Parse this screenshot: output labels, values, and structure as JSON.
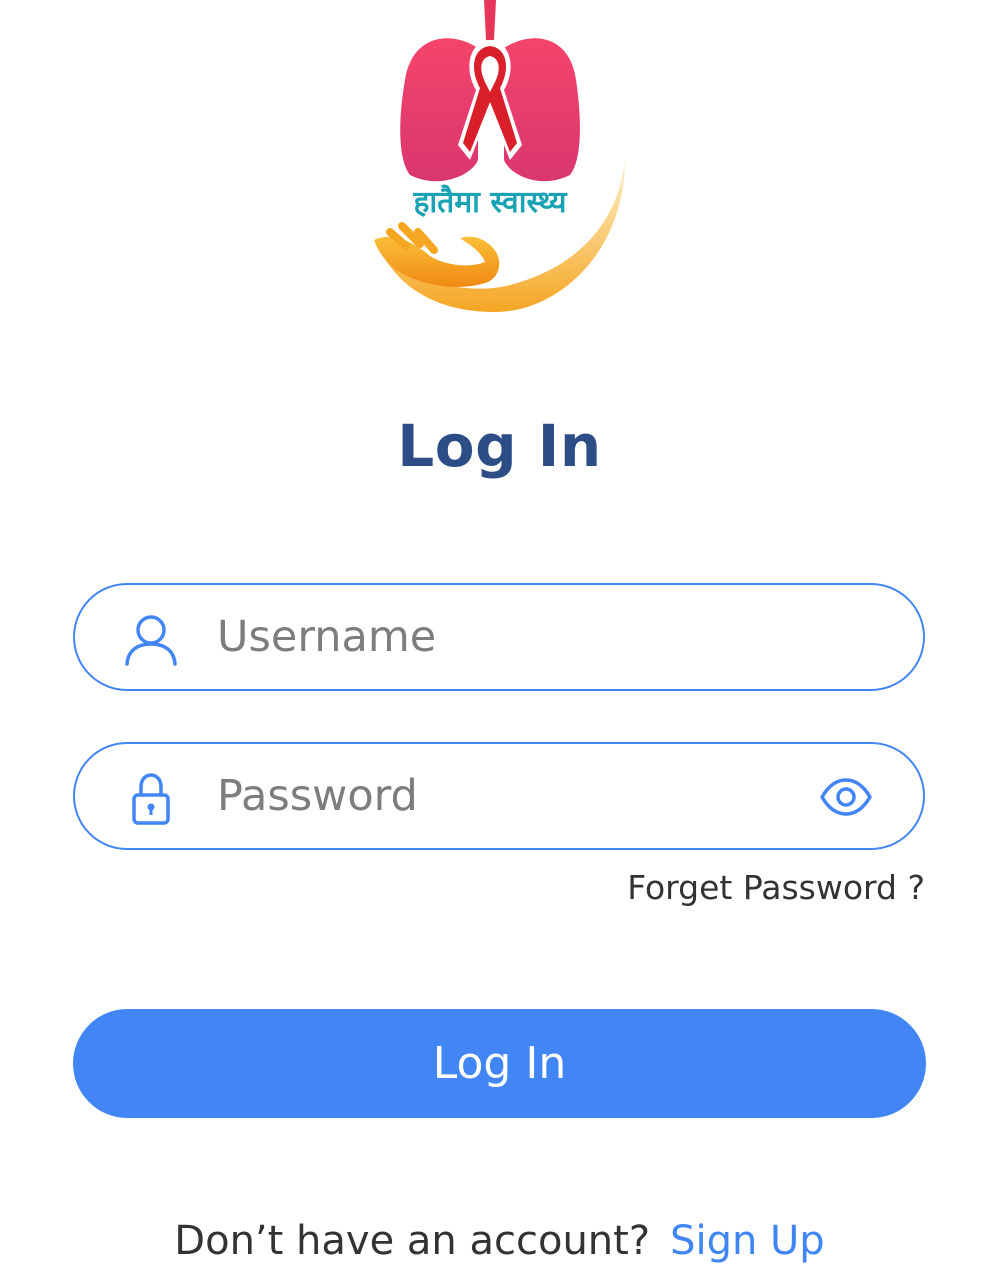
{
  "logo": {
    "text": "हातैमा स्वास्थ्य",
    "colors": {
      "lungs": "#e83a64",
      "ribbon": "#d81f2a",
      "hand": "#f39c12",
      "text": "#1aa3b5"
    }
  },
  "title": "Log In",
  "username": {
    "placeholder": "Username",
    "value": "",
    "icon": "user-icon"
  },
  "password": {
    "placeholder": "Password",
    "value": "",
    "icon": "lock-icon",
    "toggle_icon": "eye-icon"
  },
  "forgot_password": "Forget Password ?",
  "login_button": "Log In",
  "signup": {
    "prompt": "Don’t have an account?",
    "link": "Sign Up"
  },
  "colors": {
    "accent": "#4286f5",
    "title": "#2d4d87",
    "text": "#333333",
    "placeholder": "#7d7d7d"
  }
}
